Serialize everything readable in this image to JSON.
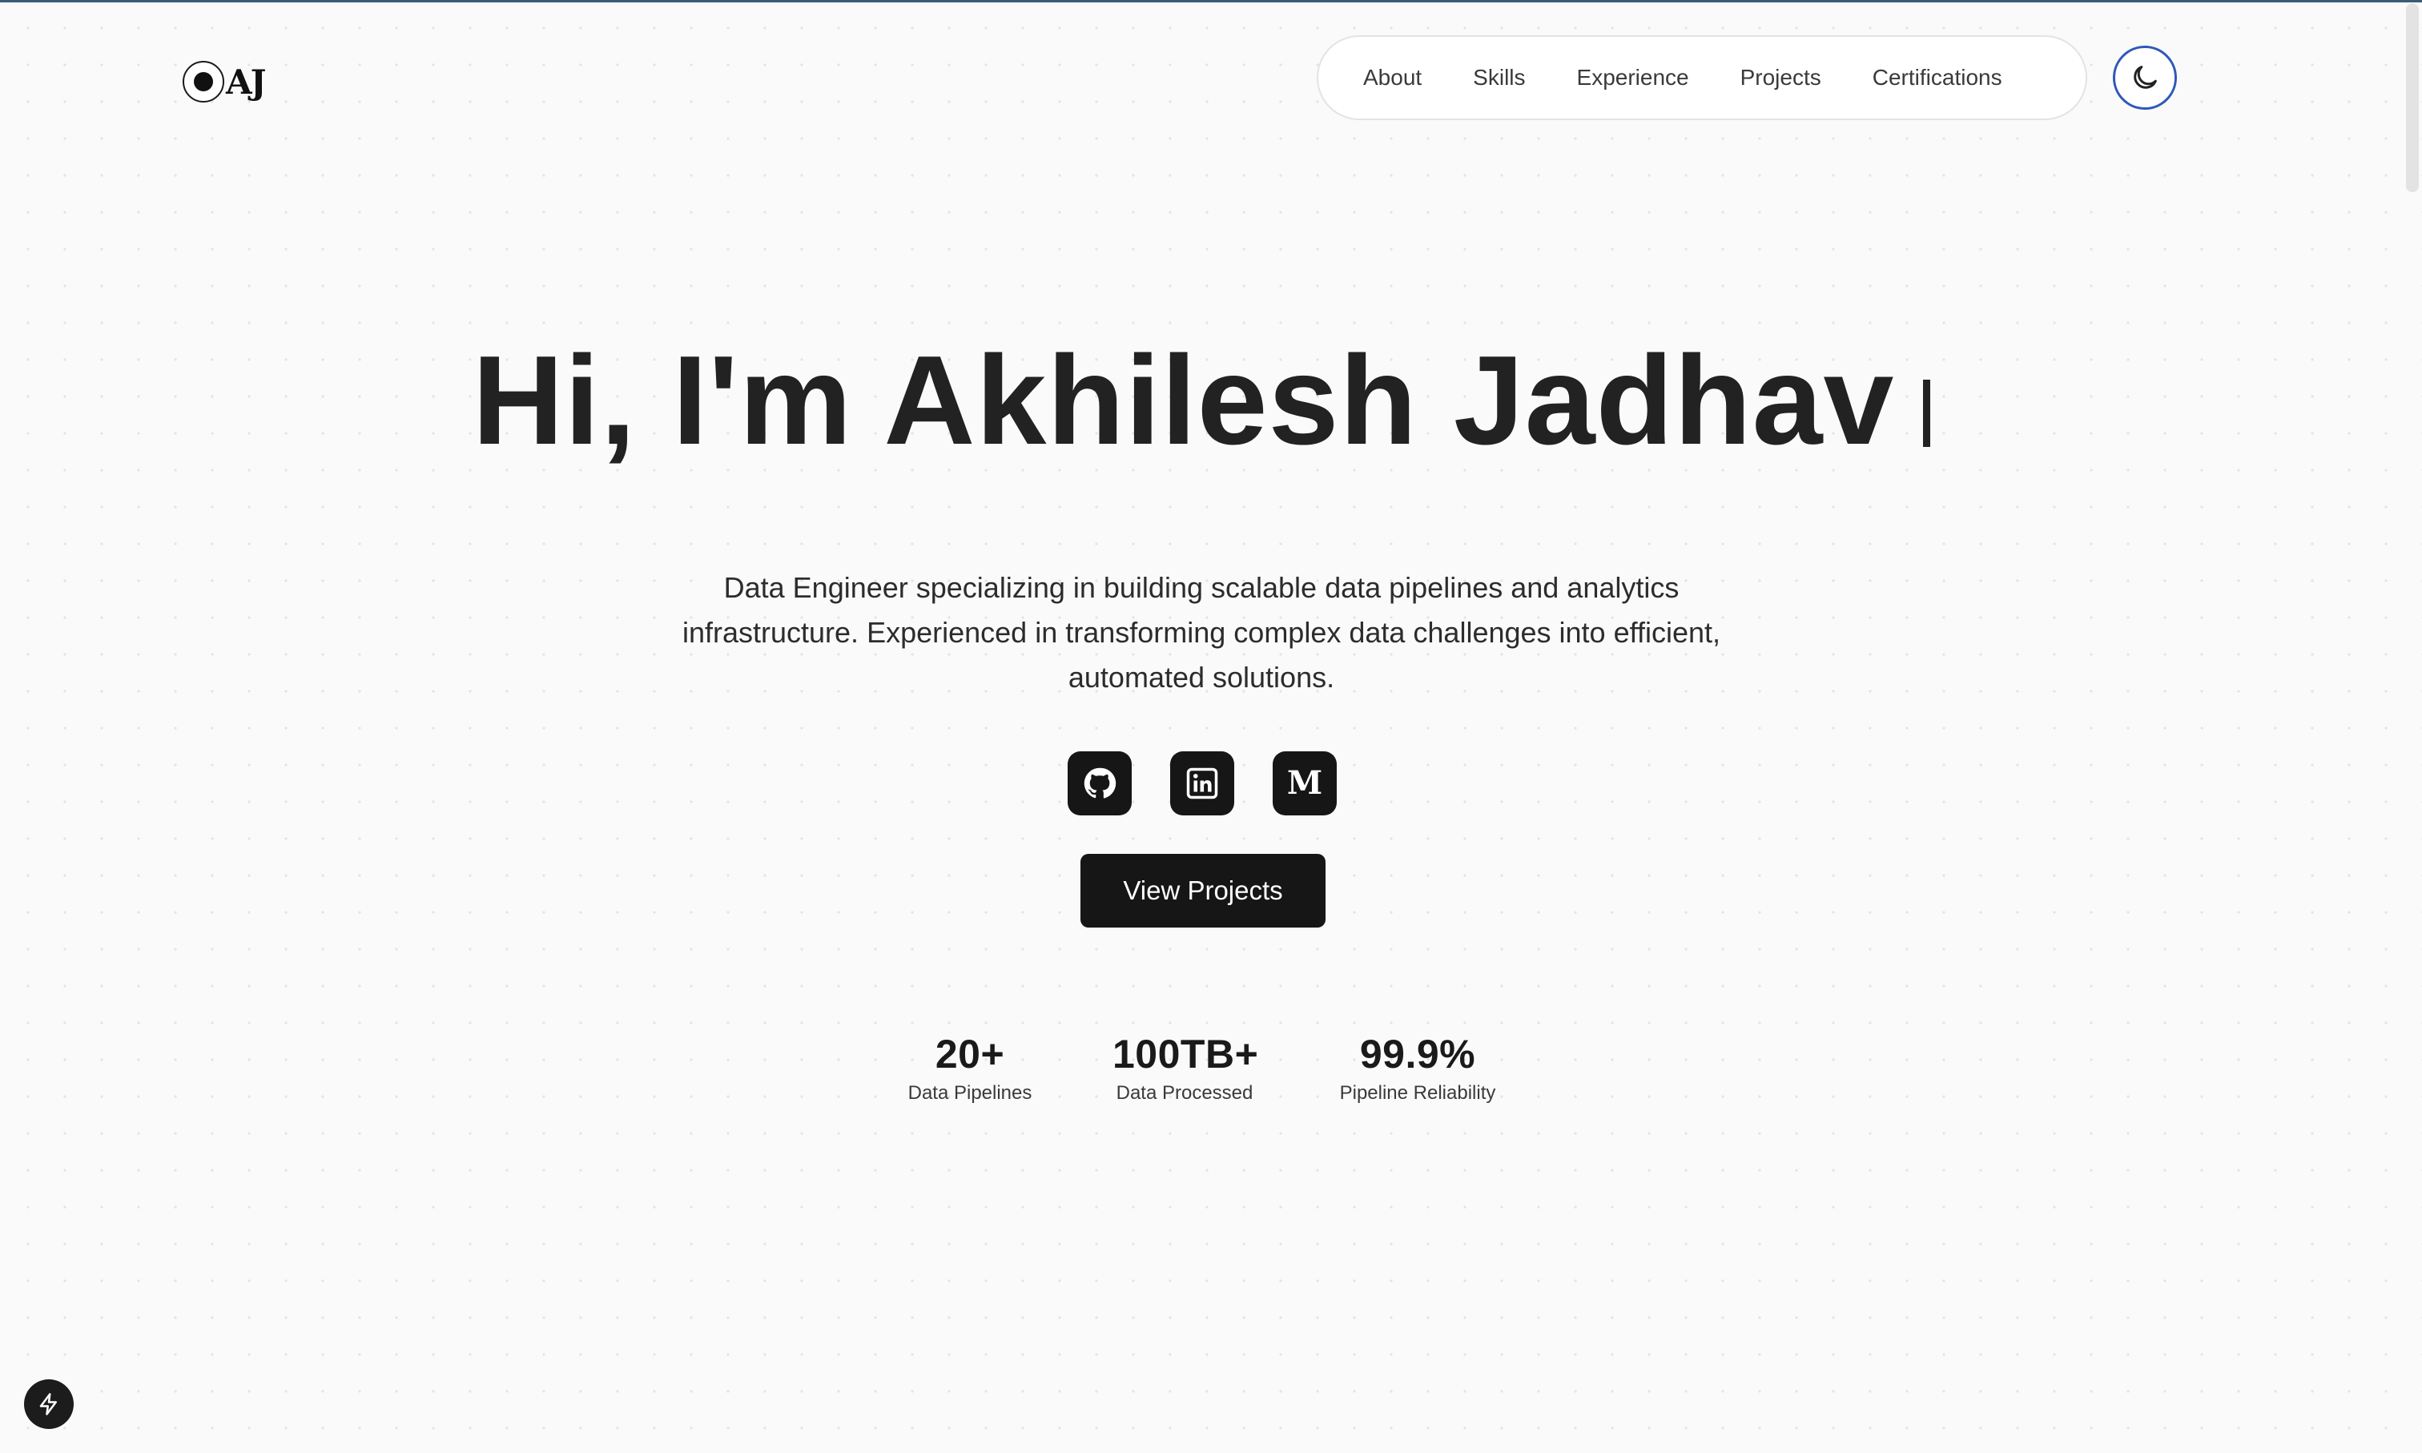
{
  "logo": {
    "text": "AJ"
  },
  "nav": {
    "items": [
      "About",
      "Skills",
      "Experience",
      "Projects",
      "Certifications"
    ]
  },
  "theme_toggle": {
    "icon": "moon-icon"
  },
  "hero": {
    "title": "Hi, I'm Akhilesh Jadhav",
    "description": "Data Engineer specializing in building scalable data pipelines and analytics infrastructure. Experienced in transforming complex data challenges into efficient, automated solutions.",
    "cta_label": "View Projects"
  },
  "social": [
    {
      "icon": "github-icon"
    },
    {
      "icon": "linkedin-icon"
    },
    {
      "icon": "medium-icon",
      "glyph": "M"
    }
  ],
  "stats": [
    {
      "value": "20+",
      "label": "Data Pipelines"
    },
    {
      "value": "100TB+",
      "label": "Data Processed"
    },
    {
      "value": "99.9%",
      "label": "Pipeline Reliability"
    }
  ],
  "colors": {
    "accent_blue": "#2f58b8",
    "dark_button": "#161616",
    "top_line": "#3b5b78"
  }
}
